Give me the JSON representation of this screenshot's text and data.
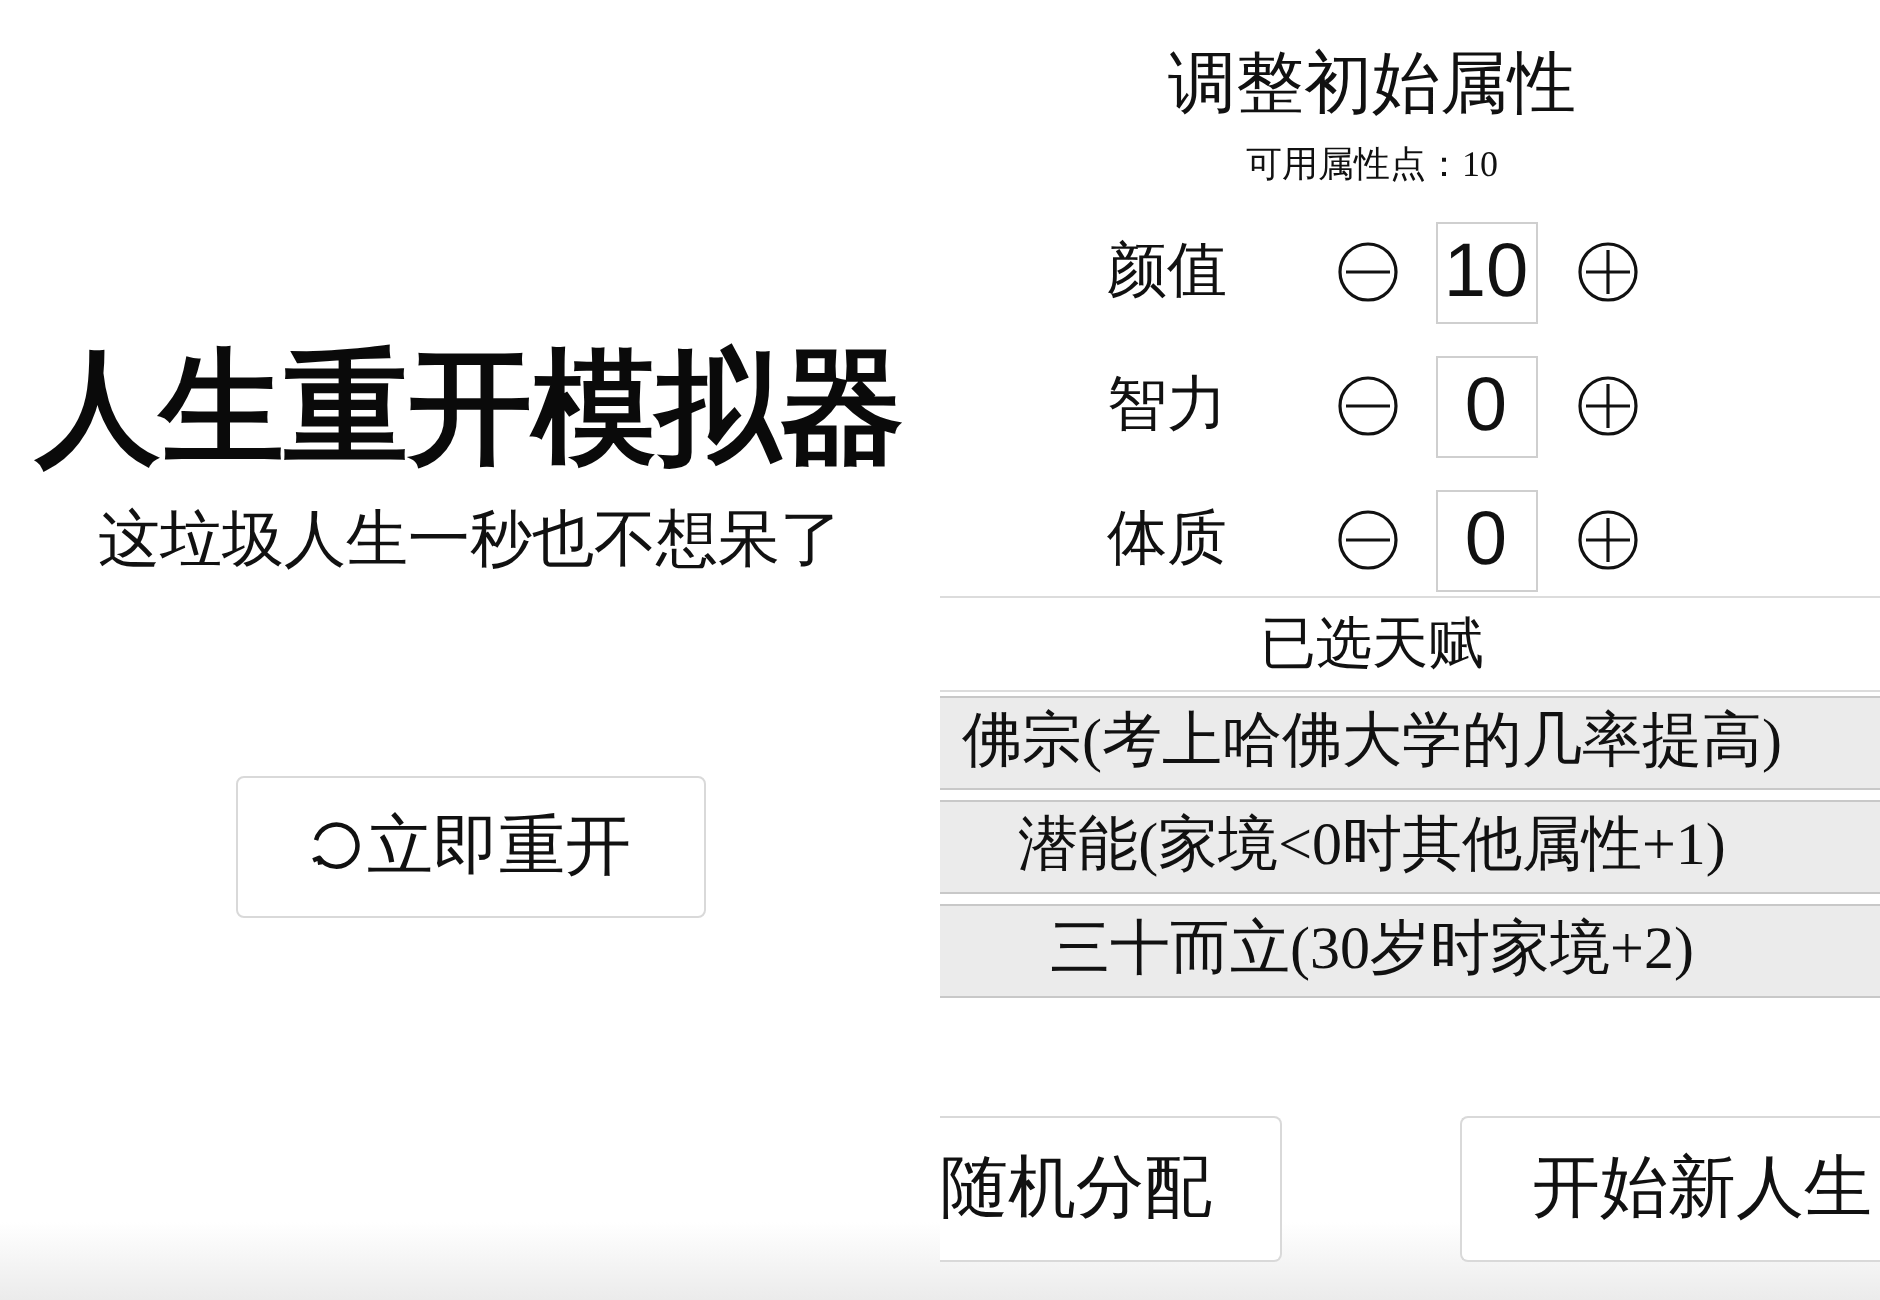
{
  "left_screen": {
    "title": "人生重开模拟器",
    "subtitle": "这垃圾人生一秒也不想呆了",
    "restart_button": {
      "label": "立即重开"
    }
  },
  "right_screen": {
    "title": "调整初始属性",
    "available_points": "可用属性点：10",
    "attributes": [
      {
        "name": "颜值",
        "value": "10"
      },
      {
        "name": "智力",
        "value": "0"
      },
      {
        "name": "体质",
        "value": "0"
      }
    ],
    "talents_heading": "已选天赋",
    "talents": [
      "佛宗(考上哈佛大学的几率提高)",
      "潜能(家境<0时其他属性+1)",
      "三十而立(30岁时家境+2)"
    ],
    "buttons": [
      {
        "label": "随机分配"
      },
      {
        "label": "开始新人生"
      }
    ]
  }
}
